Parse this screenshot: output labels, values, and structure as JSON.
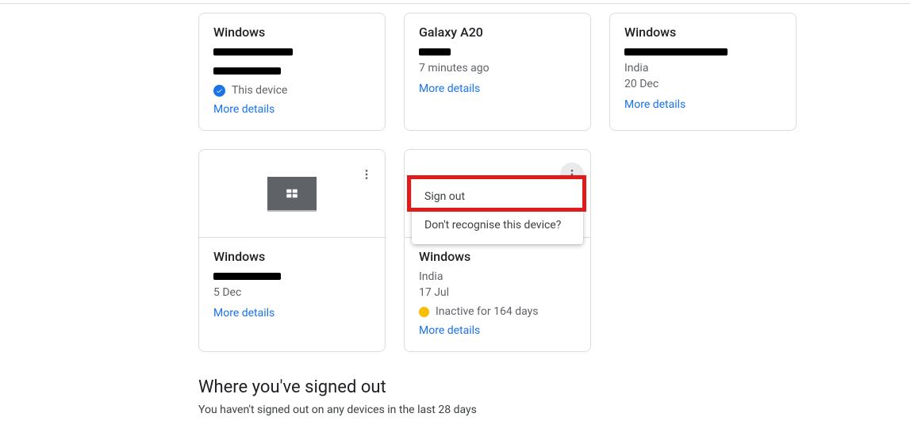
{
  "cards": {
    "c0": {
      "title": "Windows",
      "status": "This device",
      "link": "More details"
    },
    "c1": {
      "title": "Galaxy A20",
      "sub1": "7 minutes ago",
      "link": "More details"
    },
    "c2": {
      "title": "Windows",
      "sub1": "India",
      "sub2": "20 Dec",
      "link": "More details"
    },
    "c3": {
      "title": "Windows",
      "sub1": "5 Dec",
      "link": "More details"
    },
    "c4": {
      "title": "Windows",
      "sub1": "India",
      "sub2": "17 Jul",
      "status": "Inactive for 164 days",
      "link": "More details"
    }
  },
  "menu": {
    "signout": "Sign out",
    "unrecognised": "Don't recognise this device?"
  },
  "section": {
    "heading": "Where you've signed out",
    "body": "You haven't signed out on any devices in the last 28 days"
  }
}
